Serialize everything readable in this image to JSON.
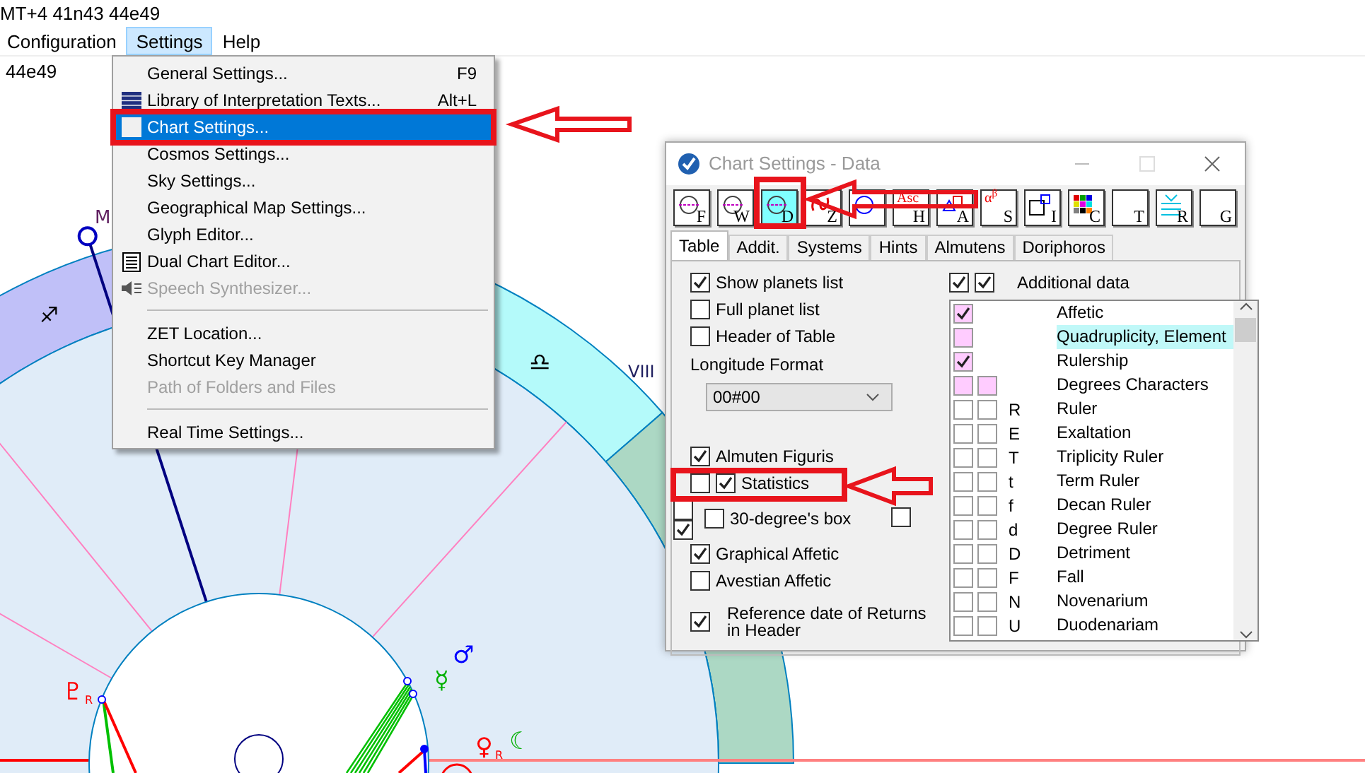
{
  "header": {
    "coords": "MT+4 41n43  44e49",
    "sub_coords": "44e49"
  },
  "menubar": [
    {
      "label": "Configuration",
      "selected": false
    },
    {
      "label": "Settings",
      "selected": true
    },
    {
      "label": "Help",
      "selected": false
    }
  ],
  "settings_menu": [
    {
      "kind": "item",
      "label": "General Settings...",
      "shortcut": "F9",
      "selected": false,
      "disabled": false
    },
    {
      "kind": "item",
      "label": "Library of Interpretation Texts...",
      "shortcut": "Alt+L",
      "selected": false,
      "disabled": false
    },
    {
      "kind": "item",
      "label": "Chart Settings...",
      "selected": true,
      "disabled": false
    },
    {
      "kind": "item",
      "label": "Cosmos Settings...",
      "selected": false,
      "disabled": false
    },
    {
      "kind": "item",
      "label": "Sky Settings...",
      "selected": false,
      "disabled": false
    },
    {
      "kind": "item",
      "label": "Geographical Map Settings...",
      "selected": false,
      "disabled": false
    },
    {
      "kind": "item",
      "label": "Glyph Editor...",
      "selected": false,
      "disabled": false
    },
    {
      "kind": "item",
      "label": "Dual Chart Editor...",
      "selected": false,
      "disabled": false
    },
    {
      "kind": "item",
      "label": "Speech Synthesizer...",
      "selected": false,
      "disabled": true
    },
    {
      "kind": "separator"
    },
    {
      "kind": "item",
      "label": "ZET Location...",
      "selected": false,
      "disabled": false
    },
    {
      "kind": "item",
      "label": "Shortcut Key Manager",
      "selected": false,
      "disabled": false
    },
    {
      "kind": "item",
      "label": "Path of Folders and Files",
      "selected": false,
      "disabled": true
    },
    {
      "kind": "separator"
    },
    {
      "kind": "item",
      "label": "Real Time Settings...",
      "selected": false,
      "disabled": false
    }
  ],
  "chart": {
    "labels": [
      {
        "text": "M",
        "color": "#602060"
      },
      {
        "text": "♐",
        "color": "#000000"
      },
      {
        "text": "♎",
        "color": "#000000"
      },
      {
        "text": "VIII",
        "color": "#202060"
      },
      {
        "text": "♂",
        "color": "#0000ff"
      },
      {
        "text": "☿",
        "color": "#00b000"
      },
      {
        "text": "♇",
        "color": "#ff0000"
      },
      {
        "text": "R",
        "color": "#ff0000"
      },
      {
        "text": "♀",
        "color": "#ff0000"
      },
      {
        "text": "R",
        "color": "#ff0000"
      },
      {
        "text": "☾",
        "color": "#00b000"
      }
    ]
  },
  "dialog": {
    "title": "Chart Settings - Data",
    "toolbar": [
      {
        "letter": "F",
        "selected": false
      },
      {
        "letter": "W",
        "selected": false
      },
      {
        "letter": "D",
        "selected": true
      },
      {
        "letter": "Z",
        "selected": false
      },
      {
        "selected": false
      },
      {
        "letter": "H",
        "glyph_text": "Asc",
        "selected": false
      },
      {
        "letter": "A",
        "selected": false
      },
      {
        "letter": "S",
        "glyph_text": "α$^{β}$",
        "selected": false
      },
      {
        "letter": "I",
        "selected": false
      },
      {
        "letter": "C",
        "selected": false
      },
      {
        "letter": "T",
        "selected": false
      },
      {
        "letter": "R",
        "selected": false
      },
      {
        "letter": "G",
        "selected": false
      }
    ],
    "tabs": [
      {
        "label": "Table",
        "selected": true
      },
      {
        "label": "Addit.",
        "selected": false
      },
      {
        "label": "Systems",
        "selected": false
      },
      {
        "label": "Hints",
        "selected": false
      },
      {
        "label": "Almutens",
        "selected": false
      },
      {
        "label": "Doriphoros",
        "selected": false
      }
    ],
    "left_options": [
      {
        "kind": "checkbox",
        "label": "Show planets list",
        "boxes": [
          {
            "checked": true
          }
        ]
      },
      {
        "kind": "checkbox",
        "label": "Full planet list",
        "boxes": [
          {
            "checked": false
          }
        ]
      },
      {
        "kind": "checkbox",
        "label": "Header of Table",
        "boxes": [
          {
            "checked": false
          }
        ]
      },
      {
        "kind": "label",
        "label": "Longitude Format"
      },
      {
        "kind": "select",
        "value": "00#00"
      },
      {
        "kind": "checkbox",
        "label": "Almuten Figuris",
        "boxes": [
          {
            "checked": true
          }
        ]
      },
      {
        "kind": "checkbox",
        "label": "Statistics",
        "boxes": [
          {
            "checked": false
          },
          {
            "checked": true
          }
        ]
      },
      {
        "kind": "checkbox",
        "label": "30-degree's box",
        "stray_boxes": [
          {
            "checked": false
          },
          {
            "checked": true
          }
        ],
        "boxes": [
          {
            "checked": false
          }
        ],
        "trailing_boxes": [
          {
            "checked": false
          }
        ]
      },
      {
        "kind": "checkbox",
        "label": "Graphical Affetic",
        "boxes": [
          {
            "checked": true
          }
        ]
      },
      {
        "kind": "checkbox",
        "label": "Avestian Affetic",
        "boxes": [
          {
            "checked": false
          }
        ]
      },
      {
        "kind": "checkbox",
        "label": "Reference date of Returns in Header",
        "boxes": [
          {
            "checked": true
          }
        ]
      }
    ],
    "additional": {
      "label": "Additional data",
      "boxes": [
        {
          "checked": true
        },
        {
          "checked": true
        }
      ],
      "rows": [
        {
          "label": "Affetic",
          "selected": false,
          "boxes": [
            {
              "color": "#ffccff",
              "checked": true
            }
          ]
        },
        {
          "label": "Quadruplicity, Element",
          "selected": true,
          "boxes": [
            {
              "color": "#ffccff",
              "checked": false
            }
          ]
        },
        {
          "label": "Rulership",
          "selected": false,
          "boxes": [
            {
              "color": "#ffccff",
              "checked": true
            }
          ]
        },
        {
          "label": "Degrees Characters",
          "selected": false,
          "boxes": [
            {
              "color": "#ffccff",
              "checked": false
            },
            {
              "color": "#ffccff",
              "checked": false
            }
          ]
        },
        {
          "code": "R",
          "label": "Ruler",
          "selected": false,
          "boxes": [
            {
              "color": "#ffffff",
              "checked": false
            },
            {
              "color": "#ffffff",
              "checked": false
            }
          ]
        },
        {
          "code": "E",
          "label": "Exaltation",
          "selected": false,
          "boxes": [
            {
              "color": "#ffffff",
              "checked": false
            },
            {
              "color": "#ffffff",
              "checked": false
            }
          ]
        },
        {
          "code": "T",
          "label": "Triplicity Ruler",
          "selected": false,
          "boxes": [
            {
              "color": "#ffffff",
              "checked": false
            },
            {
              "color": "#ffffff",
              "checked": false
            }
          ]
        },
        {
          "code": "t",
          "label": "Term Ruler",
          "selected": false,
          "boxes": [
            {
              "color": "#ffffff",
              "checked": false
            },
            {
              "color": "#ffffff",
              "checked": false
            }
          ]
        },
        {
          "code": "f",
          "label": "Decan Ruler",
          "selected": false,
          "boxes": [
            {
              "color": "#ffffff",
              "checked": false
            },
            {
              "color": "#ffffff",
              "checked": false
            }
          ]
        },
        {
          "code": "d",
          "label": "Degree Ruler",
          "selected": false,
          "boxes": [
            {
              "color": "#ffffff",
              "checked": false
            },
            {
              "color": "#ffffff",
              "checked": false
            }
          ]
        },
        {
          "code": "D",
          "label": "Detriment",
          "selected": false,
          "boxes": [
            {
              "color": "#ffffff",
              "checked": false
            },
            {
              "color": "#ffffff",
              "checked": false
            }
          ]
        },
        {
          "code": "F",
          "label": "Fall",
          "selected": false,
          "boxes": [
            {
              "color": "#ffffff",
              "checked": false
            },
            {
              "color": "#ffffff",
              "checked": false
            }
          ]
        },
        {
          "code": "N",
          "label": "Novenarium",
          "selected": false,
          "boxes": [
            {
              "color": "#ffffff",
              "checked": false
            },
            {
              "color": "#ffffff",
              "checked": false
            }
          ]
        },
        {
          "code": "U",
          "label": "Duodenariam",
          "selected": false,
          "boxes": [
            {
              "color": "#ffffff",
              "checked": false
            },
            {
              "color": "#ffffff",
              "checked": false
            }
          ]
        }
      ]
    }
  }
}
